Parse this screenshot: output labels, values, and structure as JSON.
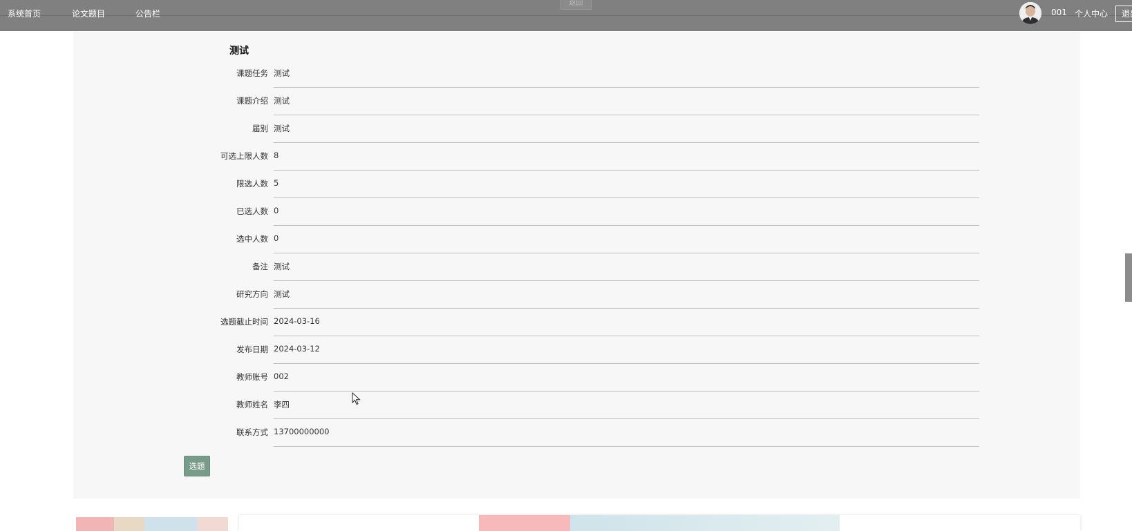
{
  "nav": {
    "items": [
      {
        "label": "系统首页"
      },
      {
        "label": "论文题目"
      },
      {
        "label": "公告栏"
      }
    ],
    "back_label": "返回",
    "user_id": "001",
    "user_center": "个人中心",
    "logout": "退出"
  },
  "detail": {
    "title": "测试",
    "fields": [
      {
        "label": "课题任务",
        "value": "测试"
      },
      {
        "label": "课题介绍",
        "value": "测试"
      },
      {
        "label": "届别",
        "value": "测试"
      },
      {
        "label": "可选上限人数",
        "value": "8"
      },
      {
        "label": "限选人数",
        "value": "5"
      },
      {
        "label": "已选人数",
        "value": "0"
      },
      {
        "label": "选中人数",
        "value": "0"
      },
      {
        "label": "备注",
        "value": "测试"
      },
      {
        "label": "研究方向",
        "value": "测试"
      },
      {
        "label": "选题截止时间",
        "value": "2024-03-16"
      },
      {
        "label": "发布日期",
        "value": "2024-03-12"
      },
      {
        "label": "教师账号",
        "value": "002"
      },
      {
        "label": "教师姓名",
        "value": "李四"
      },
      {
        "label": "联系方式",
        "value": "13700000000"
      }
    ],
    "select_button": "选题"
  },
  "icons": {
    "avatar": "user-avatar",
    "cursor": "mouse-pointer-icon"
  }
}
